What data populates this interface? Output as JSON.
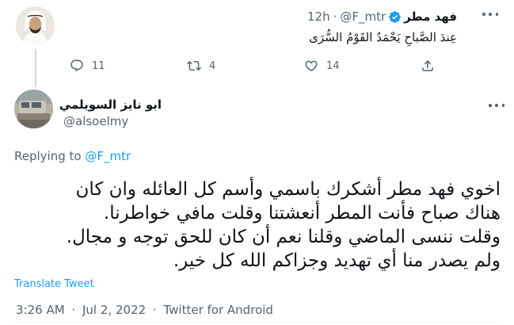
{
  "parent_tweet": {
    "author_name": "فهد مطر",
    "handle": "@F_mtr",
    "separator": "·",
    "time": "12h",
    "text": "عِندَ الصَّباحِ يَحْمَدُ القَوْمُ السُّرَى",
    "actions": {
      "reply_count": "11",
      "retweet_count": "4",
      "like_count": "14"
    }
  },
  "main_tweet": {
    "author_name": "ابو نايز السويلمي",
    "handle": "@alsoelmy",
    "replying_prefix": "Replying to",
    "replying_handle": "@F_mtr",
    "text_lines": [
      "اخوي فهد مطر أشكرك باسمي وأسم كل العائله وان كان",
      "هناك صباح فأنت المطر أنعشتنا وقلت مافي خواطرنا.",
      "وقلت ننسى الماضي وقلنا نعم أن كان للحق توجه و مجال.",
      "ولم يصدر منا أي تهديد وجزاكم الله كل خير."
    ],
    "translate_label": "Translate Tweet",
    "timestamp": "3:26 AM",
    "separator": "·",
    "date": "Jul 2, 2022",
    "source": "Twitter for Android"
  },
  "colors": {
    "accent": "#1d9bf0",
    "secondary_text": "#536471",
    "primary_text": "#0f1419",
    "divider": "#eff3f4"
  }
}
